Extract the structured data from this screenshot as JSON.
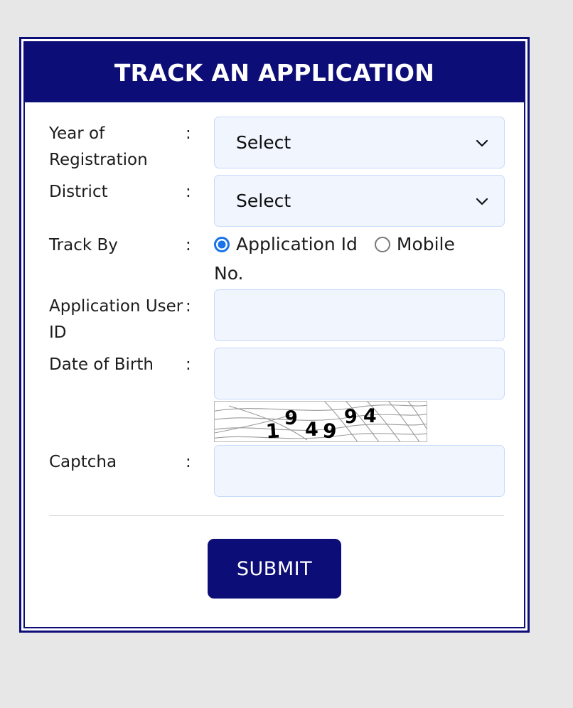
{
  "header": {
    "title": "TRACK AN APPLICATION"
  },
  "colors": {
    "navy": "#0d0d77",
    "field_bg": "#f0f5fe",
    "field_border": "#c8dafb",
    "radio_selected": "#1a73e8",
    "page_bg": "#e7e7e7"
  },
  "form": {
    "separator": ":",
    "rows": {
      "year": {
        "label": "Year of Registration",
        "selected": "Select",
        "icon": "chevron-down-icon"
      },
      "district": {
        "label": "District",
        "selected": "Select",
        "icon": "chevron-down-icon"
      },
      "track_by": {
        "label": "Track By",
        "options": [
          {
            "label": "Application Id",
            "selected": true
          },
          {
            "label": "Mobile No.",
            "selected": false
          }
        ]
      },
      "application_user_id": {
        "label": "Application User ID",
        "value": "",
        "placeholder": ""
      },
      "date_of_birth": {
        "label": "Date of Birth",
        "value": "",
        "placeholder": ""
      },
      "captcha": {
        "label": "Captcha",
        "value": "",
        "placeholder": "",
        "image_text": "194994"
      }
    }
  },
  "actions": {
    "submit_label": "SUBMIT"
  }
}
